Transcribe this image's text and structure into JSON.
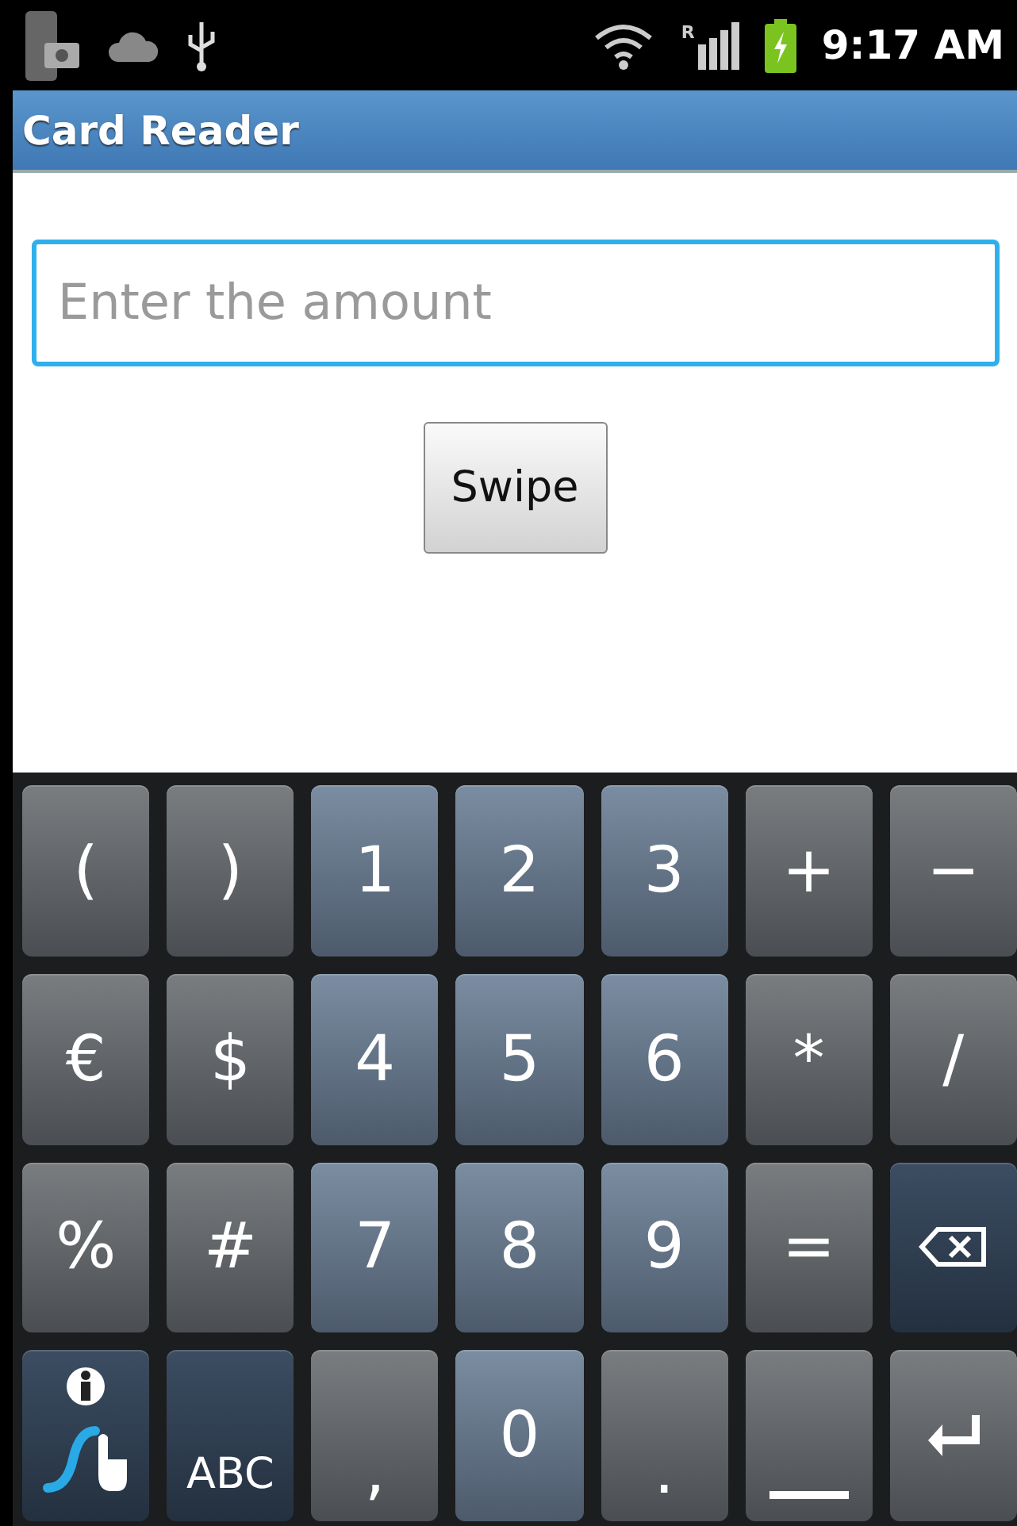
{
  "status_bar": {
    "time": "9:17 AM",
    "signal_label": "R"
  },
  "title_bar": {
    "title": "Card Reader"
  },
  "amount_field": {
    "placeholder": "Enter the amount",
    "focused": true
  },
  "swipe_button": {
    "label": "Swipe"
  },
  "keyboard": {
    "rows": [
      [
        {
          "kind": "symbol",
          "label": "("
        },
        {
          "kind": "symbol",
          "label": ")"
        },
        {
          "kind": "digit",
          "label": "1"
        },
        {
          "kind": "digit",
          "label": "2"
        },
        {
          "kind": "digit",
          "label": "3"
        },
        {
          "kind": "symbol",
          "label": "+"
        },
        {
          "kind": "symbol",
          "label": "−"
        }
      ],
      [
        {
          "kind": "symbol",
          "label": "€"
        },
        {
          "kind": "symbol",
          "label": "$"
        },
        {
          "kind": "digit",
          "label": "4"
        },
        {
          "kind": "digit",
          "label": "5"
        },
        {
          "kind": "digit",
          "label": "6"
        },
        {
          "kind": "symbol",
          "label": "*"
        },
        {
          "kind": "symbol",
          "label": "/"
        }
      ],
      [
        {
          "kind": "symbol",
          "label": "%"
        },
        {
          "kind": "symbol",
          "label": "#"
        },
        {
          "kind": "digit",
          "label": "7"
        },
        {
          "kind": "digit",
          "label": "8"
        },
        {
          "kind": "digit",
          "label": "9"
        },
        {
          "kind": "symbol",
          "label": "="
        },
        {
          "kind": "backspace"
        }
      ],
      [
        {
          "kind": "swype"
        },
        {
          "kind": "mode",
          "label": "ABC"
        },
        {
          "kind": "punct",
          "label": ","
        },
        {
          "kind": "digit",
          "label": "0"
        },
        {
          "kind": "punct",
          "label": "."
        },
        {
          "kind": "space"
        },
        {
          "kind": "enter"
        }
      ]
    ]
  }
}
